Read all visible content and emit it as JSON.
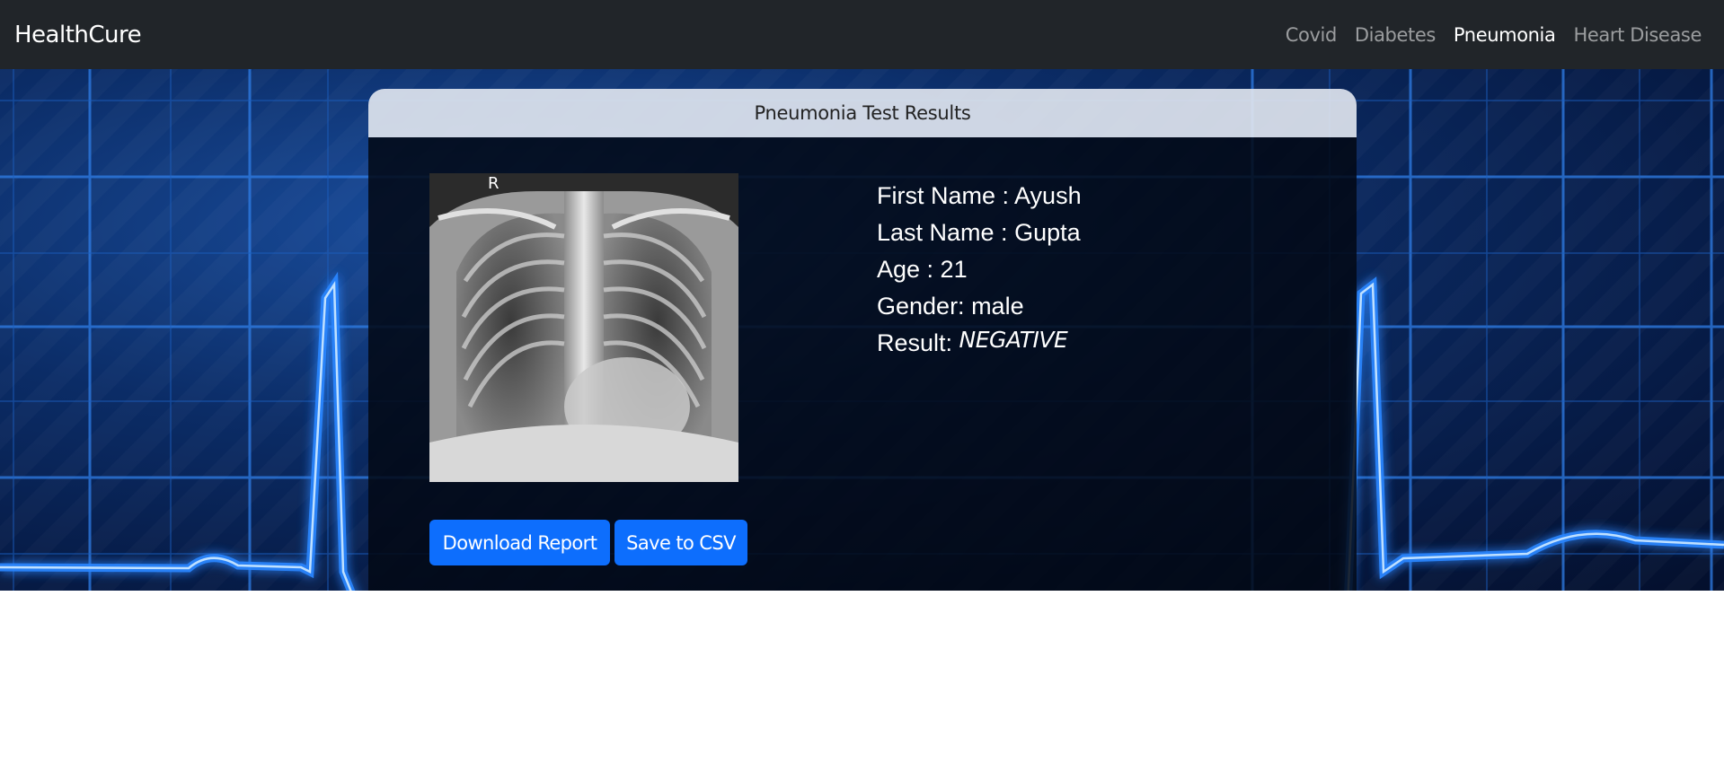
{
  "navbar": {
    "brand": "HealthCure",
    "links": [
      "Covid",
      "Diabetes",
      "Pneumonia",
      "Heart Disease"
    ],
    "active": "Pneumonia"
  },
  "card": {
    "title": "Pneumonia Test Results",
    "xray_marker": "R",
    "first_name_label": "First Name : ",
    "first_name": "Ayush",
    "last_name_label": "Last Name : ",
    "last_name": "Gupta",
    "age_label": "Age : ",
    "age": "21",
    "gender_label": "Gender: ",
    "gender": "male",
    "result_label": "Result: ",
    "result": "NEGATIVE",
    "download_button": "Download Report",
    "csv_button": "Save to CSV"
  },
  "colors": {
    "navbar_bg": "#212529",
    "primary_button": "#0d6efd",
    "hero_blue": "#0b2c66",
    "ecg_line": "#3a8cff"
  }
}
